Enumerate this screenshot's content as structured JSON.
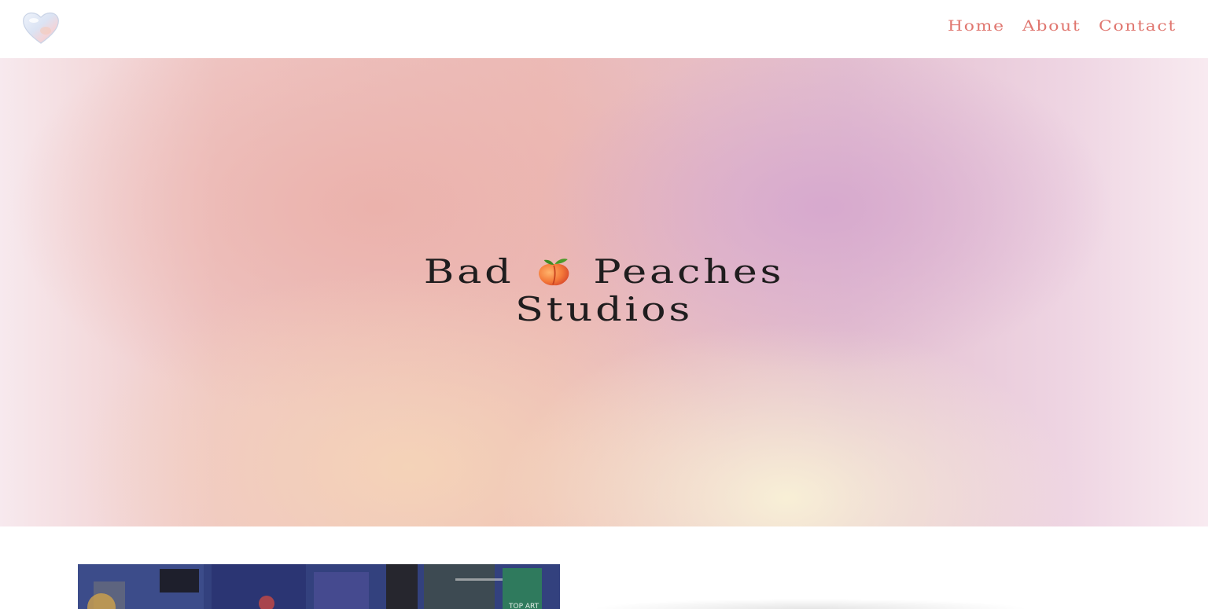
{
  "nav": {
    "items": [
      {
        "label": "Home"
      },
      {
        "label": "About"
      },
      {
        "label": "Contact"
      }
    ],
    "color": "#e0766f"
  },
  "logo": {
    "icon": "heart-icon"
  },
  "hero": {
    "title_line1_left": "Bad",
    "title_line1_right": "Peaches",
    "title_line2": "Studios",
    "emoji_icon": "peach-icon"
  },
  "media": {
    "photo_label": "TOP ART"
  }
}
